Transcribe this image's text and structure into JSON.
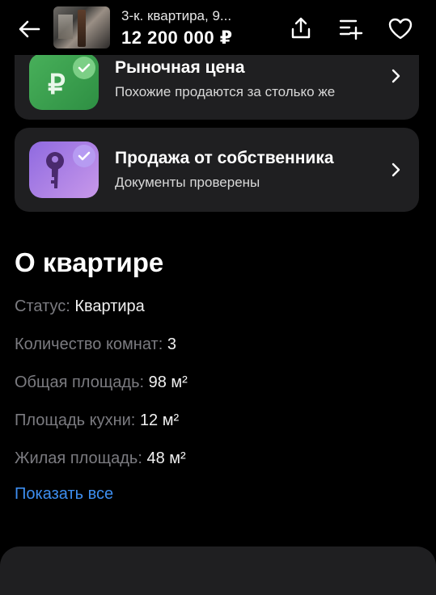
{
  "header": {
    "title": "3-к. квартира, 9...",
    "price": "12 200 000 ₽"
  },
  "cards": [
    {
      "title": "Рыночная цена",
      "subtitle": "Похожие продаются за столько же",
      "icon": "ruble-badge-icon"
    },
    {
      "title": "Продажа от собственника",
      "subtitle": "Документы проверены",
      "icon": "key-badge-icon"
    }
  ],
  "about": {
    "title": "О квартире",
    "props": [
      {
        "key": "Статус:",
        "value": "Квартира"
      },
      {
        "key": "Количество комнат:",
        "value": "3"
      },
      {
        "key": "Общая площадь:",
        "value": "98 м²"
      },
      {
        "key": "Площадь кухни:",
        "value": "12 м²"
      },
      {
        "key": "Жилая площадь:",
        "value": "48 м²"
      }
    ],
    "show_all": "Показать все"
  },
  "colors": {
    "background": "#000000",
    "card": "#1f1f21",
    "link": "#3d8ef0",
    "market_badge": "#48b05a",
    "owner_badge": "#8f6ae0"
  }
}
